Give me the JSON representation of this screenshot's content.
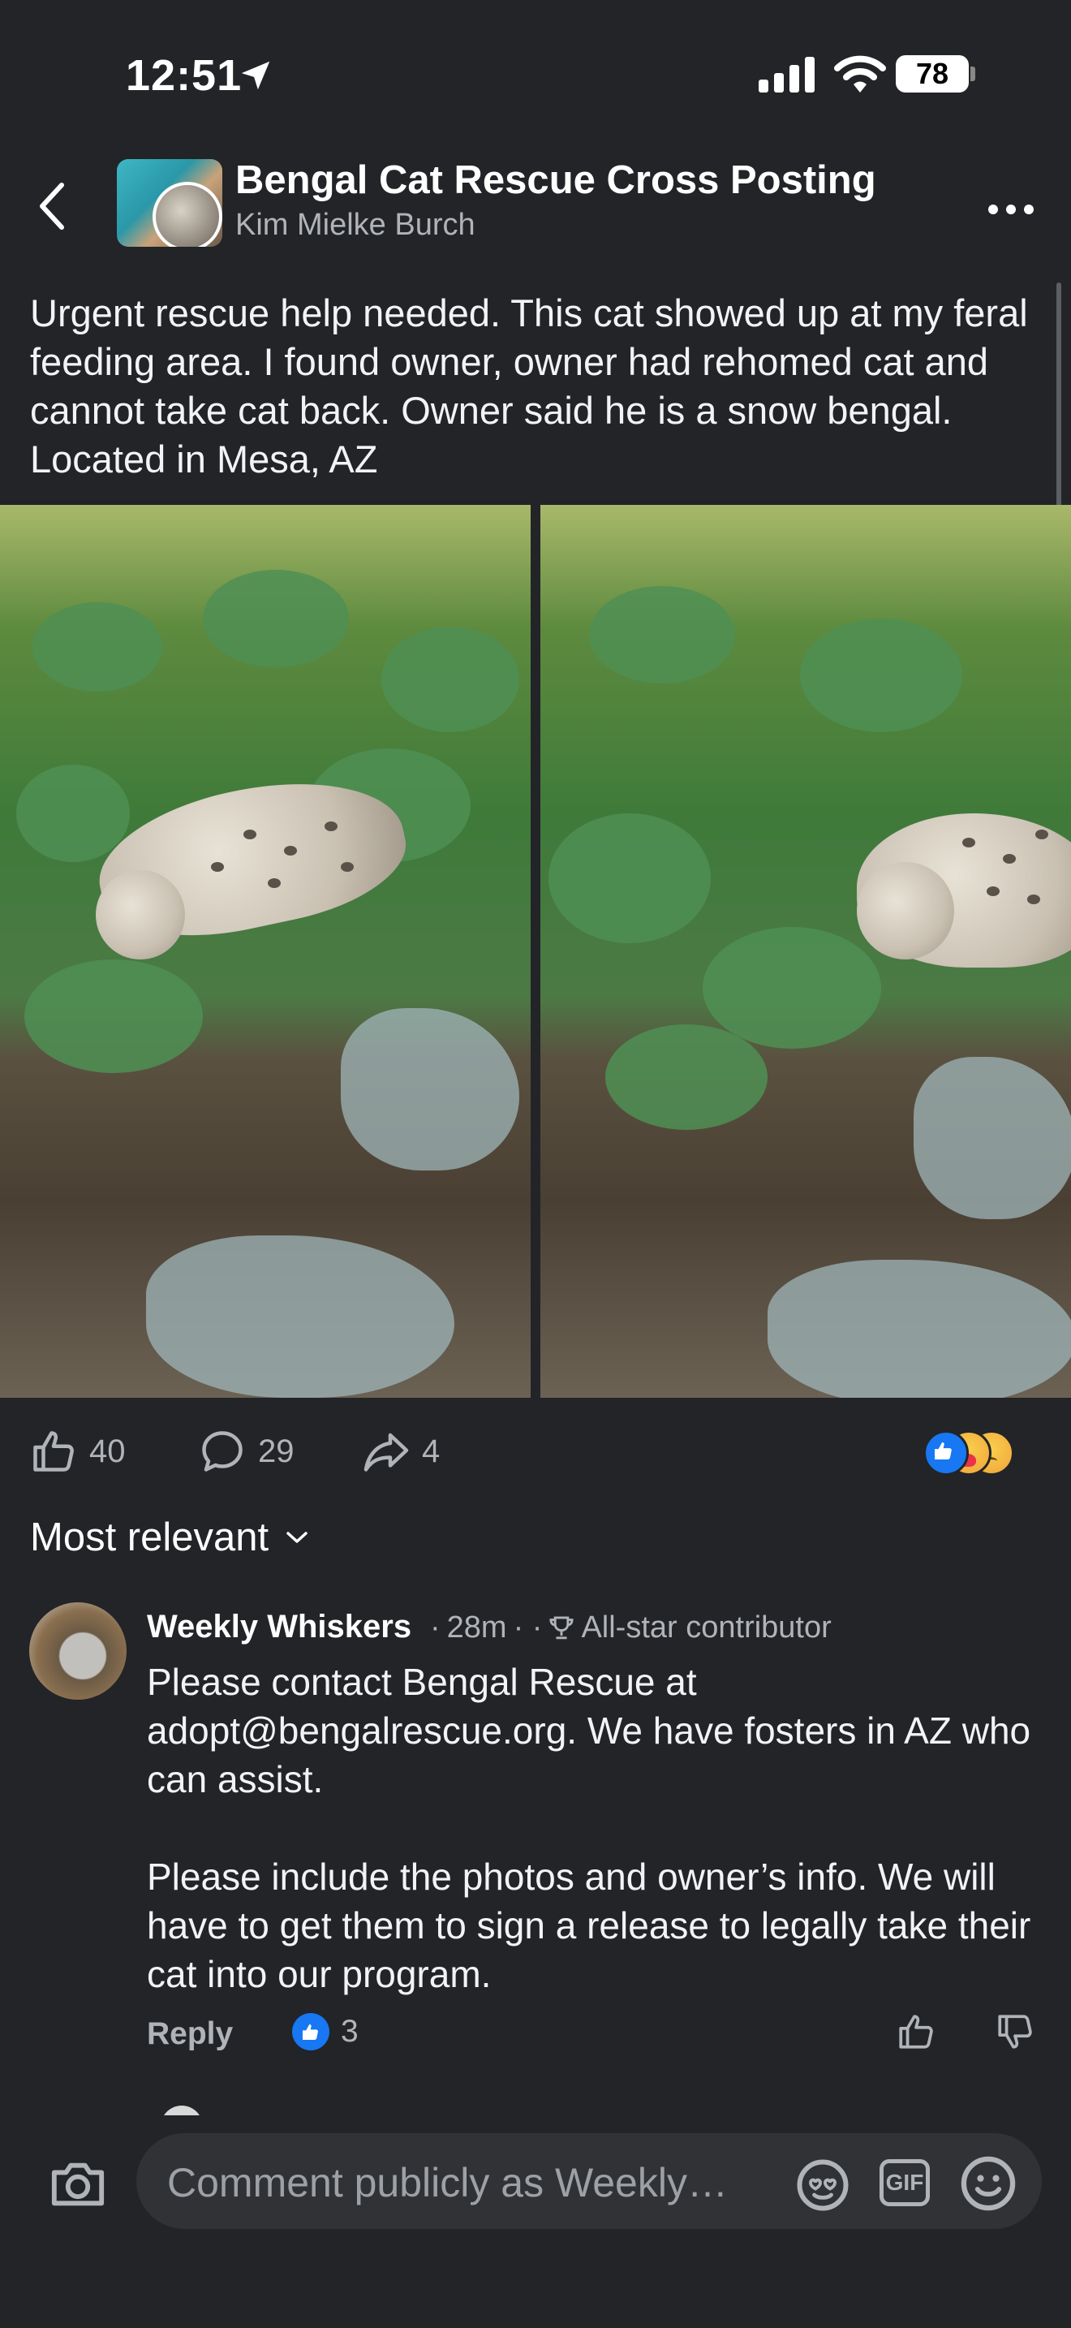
{
  "status": {
    "time": "12:51",
    "battery": "78"
  },
  "header": {
    "group_title": "Bengal Cat Rescue Cross Posting",
    "author": "Kim Mielke Burch"
  },
  "post": {
    "text": "Urgent rescue help needed.  This cat showed up at my feral feeding area.  I found owner, owner had rehomed cat and cannot take cat back.  Owner said he is a snow bengal.  Located in Mesa, AZ",
    "likes": "40",
    "comments": "29",
    "shares": "4"
  },
  "sort": {
    "label": "Most relevant"
  },
  "comment": {
    "name": "Weekly Whiskers",
    "time": "28m",
    "badge": "All-star contributor",
    "text": "Please contact Bengal Rescue at adopt@bengalrescue.org. We have fosters in AZ who can assist.\n\nPlease include the photos and owner’s info. We will have to get them to sign a release to legally take their cat into our program.",
    "reply_label": "Reply",
    "likes": "3"
  },
  "composer": {
    "placeholder": "Comment publicly as Weekly…",
    "gif_label": "GIF"
  },
  "icons": {
    "location": "location-arrow-icon",
    "signal": "cellular-signal-icon",
    "wifi": "wifi-icon",
    "back": "back-chevron-icon",
    "more": "more-options-icon",
    "like": "thumbs-up-icon",
    "comment": "comment-bubble-icon",
    "share": "share-arrow-icon",
    "camera": "camera-icon",
    "avatar": "avatar-sticker-icon",
    "emoji": "smiley-icon"
  },
  "colors": {
    "background": "#222427",
    "like_blue": "#1877f2",
    "secondary_text": "#b0b3b8"
  }
}
